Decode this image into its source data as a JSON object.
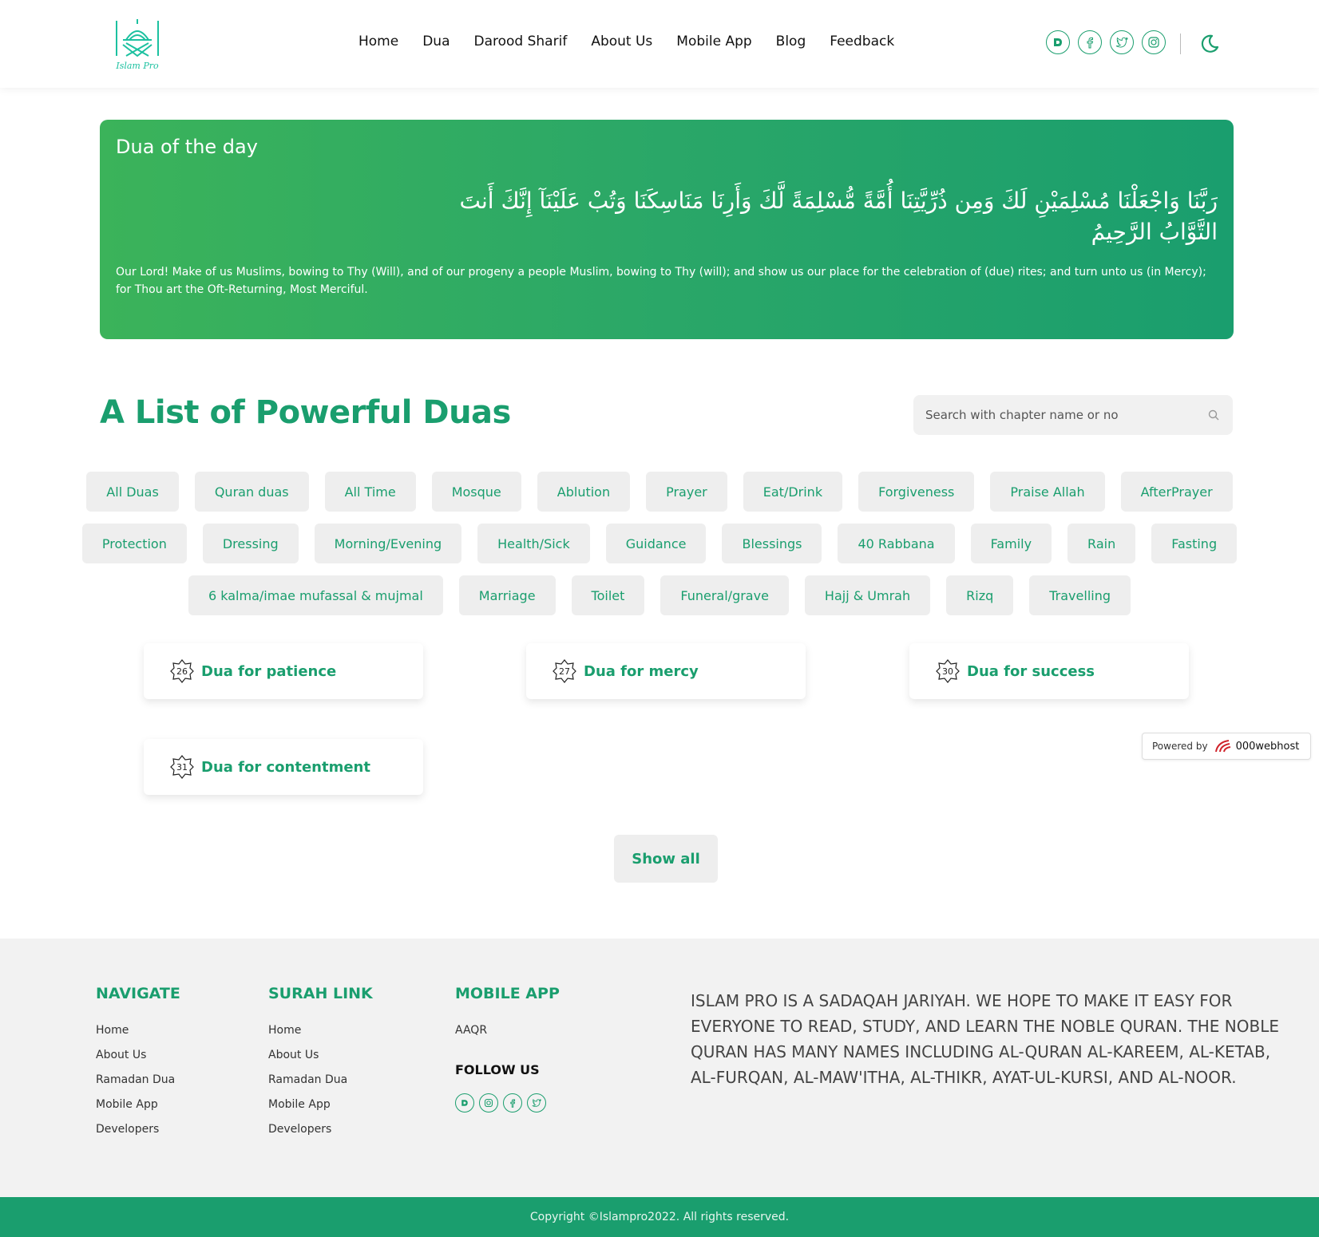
{
  "colors": {
    "brand": "#1a9e6e",
    "gradient_start": "#3bb35a",
    "gradient_end": "#1a9e6e",
    "chip_bg": "#eeeeee"
  },
  "header": {
    "logo_text": "Islam Pro",
    "nav": [
      "Home",
      "Dua",
      "Darood Sharif",
      "About Us",
      "Mobile App",
      "Blog",
      "Feedback"
    ],
    "social_icons": [
      "dailymotion-icon",
      "facebook-icon",
      "twitter-icon",
      "instagram-icon"
    ],
    "theme_icon": "moon-icon"
  },
  "dua_of_day": {
    "title": "Dua of the day",
    "arabic": "رَبَّنَا وَاجْعَلْنَا مُسْلِمَيْنِ لَكَ وَمِن ذُرِّيَّتِنَا أُمَّةً مُّسْلِمَةً لَّكَ وَأَرِنَا مَنَاسِكَنَا وَتُبْ عَلَيْنَآ إِنَّكَ أَنتَ التَّوَّابُ الرَّحِيمُ",
    "translation": "Our Lord! Make of us Muslims, bowing to Thy (Will), and of our progeny a people Muslim, bowing to Thy (will); and show us our place for the celebration of (due) rites; and turn unto us (in Mercy); for Thou art the Oft-Returning, Most Merciful."
  },
  "list": {
    "title": "A List of Powerful Duas",
    "search_placeholder": "Search with chapter name or no",
    "categories_row1": [
      "All Duas",
      "Quran duas",
      "All Time",
      "Mosque",
      "Ablution",
      "Prayer",
      "Eat/Drink",
      "Forgiveness",
      "Praise Allah",
      "AfterPrayer"
    ],
    "categories_row2": [
      "Protection",
      "Dressing",
      "Morning/Evening",
      "Health/Sick",
      "Guidance",
      "Blessings",
      "40 Rabbana",
      "Family",
      "Rain",
      "Fasting"
    ],
    "categories_row3": [
      "6 kalma/imae mufassal & mujmal",
      "Marriage",
      "Toilet",
      "Funeral/grave",
      "Hajj & Umrah",
      "Rizq",
      "Travelling"
    ],
    "duas": [
      {
        "number": "26",
        "title": "Dua for patience"
      },
      {
        "number": "27",
        "title": "Dua for mercy"
      },
      {
        "number": "30",
        "title": "Dua for success"
      },
      {
        "number": "31",
        "title": "Dua for contentment"
      }
    ],
    "show_all": "Show all"
  },
  "powered_by": {
    "label": "Powered by",
    "name": "000webhost"
  },
  "footer": {
    "navigate": {
      "title": "NAVIGATE",
      "links": [
        "Home",
        "About Us",
        "Ramadan Dua",
        "Mobile App",
        "Developers"
      ]
    },
    "surah_link": {
      "title": "SURAH LINK",
      "links": [
        "Home",
        "About Us",
        "Ramadan Dua",
        "Mobile App",
        "Developers"
      ]
    },
    "mobile_app": {
      "title": "MOBILE APP",
      "links": [
        "AAQR"
      ],
      "follow_title": "FOLLOW US",
      "follow_icons": [
        "dailymotion-icon",
        "instagram-icon",
        "facebook-icon",
        "twitter-icon"
      ]
    },
    "about": "Islam Pro is a Sadaqah Jariyah. We hope to make it easy for everyone to read, study, and learn The Noble Quran. The Noble Quran has many names including Al-Quran Al-Kareem, Al-Ketab, Al-Furqan, Al-Maw'itha, Al-Thikr, Ayat-ul-Kursi, and Al-Noor.",
    "copyright": "Copyright ©Islampro2022. All rights reserved."
  }
}
